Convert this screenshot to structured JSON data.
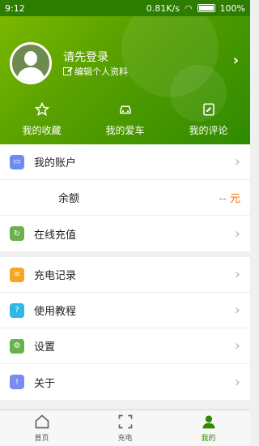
{
  "status_bar": {
    "time": "9:12",
    "network_speed": "0.81K/s",
    "battery": "100%"
  },
  "profile": {
    "login_prompt": "请先登录",
    "edit_profile": "编辑个人资料"
  },
  "quick_actions": [
    {
      "label": "我的收藏",
      "icon": "star-icon"
    },
    {
      "label": "我的爱车",
      "icon": "car-icon"
    },
    {
      "label": "我的评论",
      "icon": "comment-edit-icon"
    }
  ],
  "account_section": {
    "my_account": "我的账户",
    "balance_label": "余额",
    "balance_value": "-- 元",
    "online_recharge": "在线充值"
  },
  "menu_section": [
    {
      "label": "充电记录",
      "icon": "record-icon",
      "color": "#f5a623"
    },
    {
      "label": "使用教程",
      "icon": "help-icon",
      "color": "#2fb7e6"
    },
    {
      "label": "设置",
      "icon": "settings-icon",
      "color": "#6ab04c"
    },
    {
      "label": "关于",
      "icon": "info-icon",
      "color": "#7b8cf0"
    }
  ],
  "bottom_nav": [
    {
      "label": "首页",
      "icon": "home-icon"
    },
    {
      "label": "充电",
      "icon": "scan-icon"
    },
    {
      "label": "我的",
      "icon": "user-icon"
    }
  ],
  "colors": {
    "brand_green": "#2f8a00",
    "balance_orange": "#ff6a00"
  }
}
